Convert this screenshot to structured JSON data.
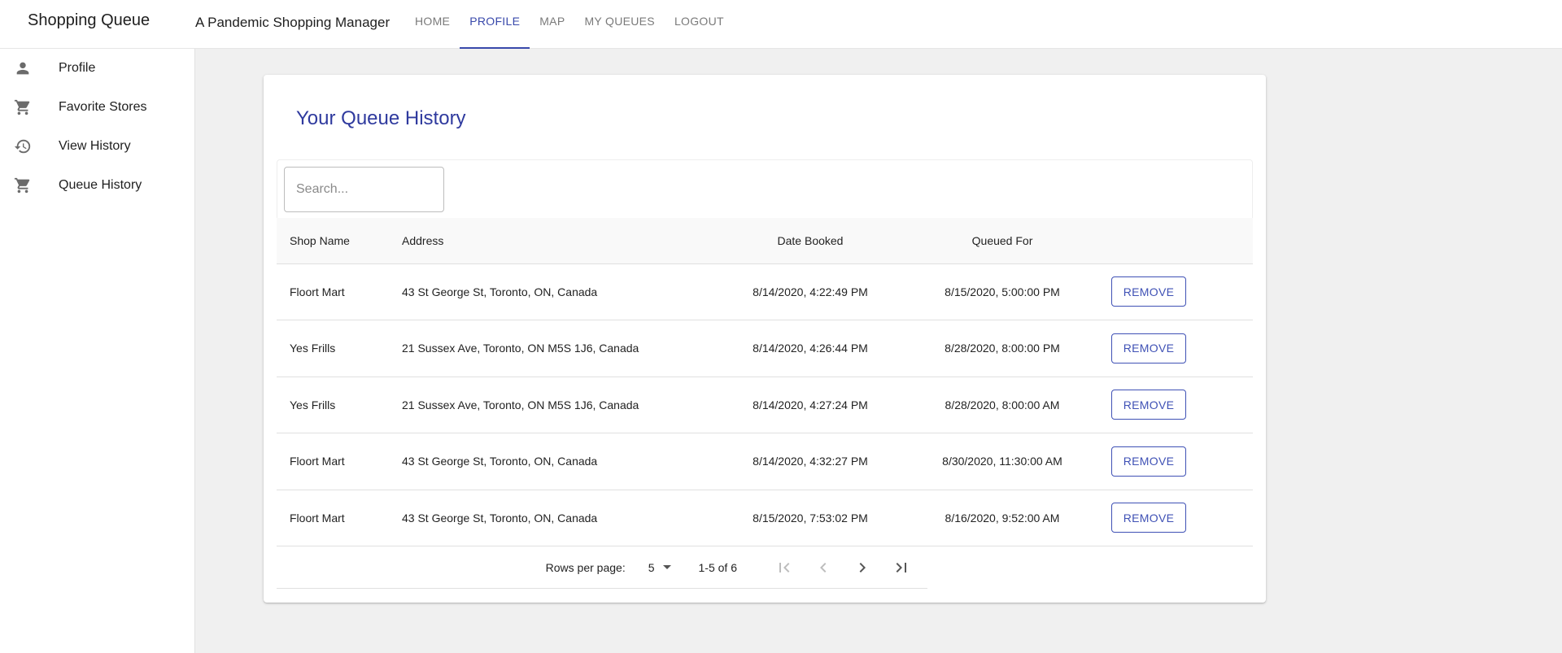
{
  "app": {
    "brand": "Shopping Queue",
    "subtitle": "A Pandemic Shopping Manager"
  },
  "nav": {
    "items": [
      {
        "label": "HOME"
      },
      {
        "label": "PROFILE",
        "active": true
      },
      {
        "label": "MAP"
      },
      {
        "label": "MY QUEUES"
      },
      {
        "label": "LOGOUT"
      }
    ]
  },
  "sidebar": {
    "items": [
      {
        "label": "Profile",
        "icon": "person-icon"
      },
      {
        "label": "Favorite Stores",
        "icon": "cart-icon"
      },
      {
        "label": "View History",
        "icon": "history-icon"
      },
      {
        "label": "Queue History",
        "icon": "cart-icon"
      }
    ]
  },
  "card": {
    "title": "Your Queue History"
  },
  "search": {
    "placeholder": "Search..."
  },
  "table": {
    "headers": [
      "Shop Name",
      "Address",
      "Date Booked",
      "Queued For",
      ""
    ],
    "rows": [
      {
        "shop": "Floort Mart",
        "address": "43 St George St, Toronto, ON, Canada",
        "booked": "8/14/2020, 4:22:49 PM",
        "queued": "8/15/2020, 5:00:00 PM",
        "action": "REMOVE"
      },
      {
        "shop": "Yes Frills",
        "address": "21 Sussex Ave, Toronto, ON M5S 1J6, Canada",
        "booked": "8/14/2020, 4:26:44 PM",
        "queued": "8/28/2020, 8:00:00 PM",
        "action": "REMOVE"
      },
      {
        "shop": "Yes Frills",
        "address": "21 Sussex Ave, Toronto, ON M5S 1J6, Canada",
        "booked": "8/14/2020, 4:27:24 PM",
        "queued": "8/28/2020, 8:00:00 AM",
        "action": "REMOVE"
      },
      {
        "shop": "Floort Mart",
        "address": "43 St George St, Toronto, ON, Canada",
        "booked": "8/14/2020, 4:32:27 PM",
        "queued": "8/30/2020, 11:30:00 AM",
        "action": "REMOVE"
      },
      {
        "shop": "Floort Mart",
        "address": "43 St George St, Toronto, ON, Canada",
        "booked": "8/15/2020, 7:53:02 PM",
        "queued": "8/16/2020, 9:52:00 AM",
        "action": "REMOVE"
      }
    ]
  },
  "pagination": {
    "rows_per_page_label": "Rows per page:",
    "rows_per_page_value": "5",
    "range": "1-5 of 6",
    "first_disabled": true,
    "prev_disabled": true,
    "next_disabled": false,
    "last_disabled": false
  },
  "colors": {
    "accent": "#3949ab",
    "title": "#2f3a9e",
    "background": "#f0f0f0"
  }
}
